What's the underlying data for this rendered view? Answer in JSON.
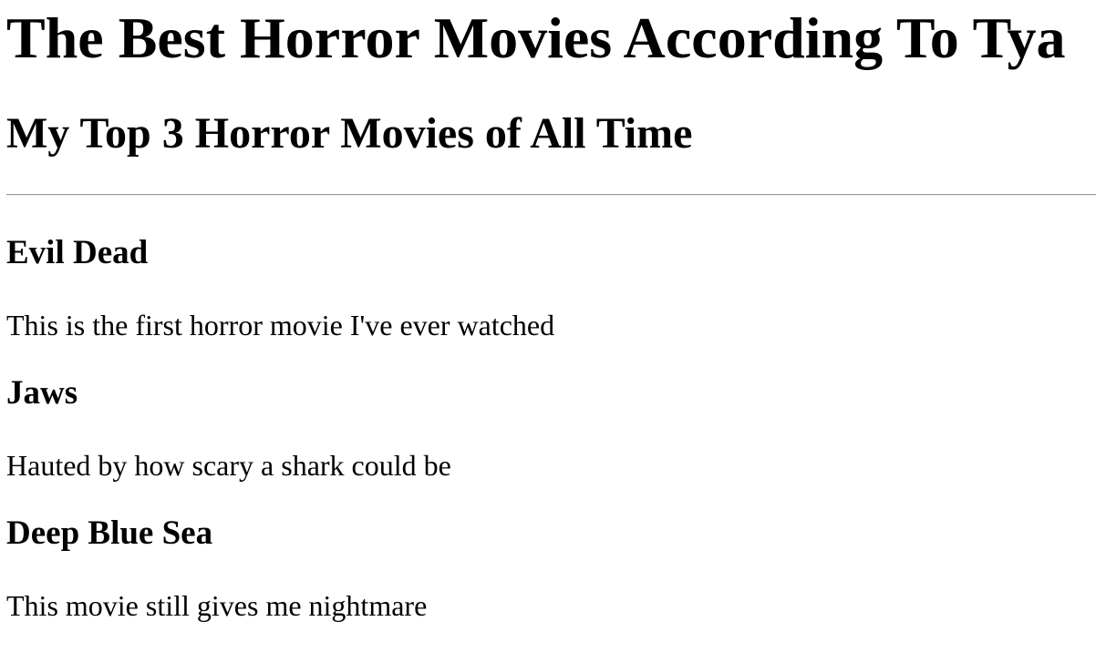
{
  "page": {
    "title": "The Best Horror Movies According To Tya",
    "subtitle": "My Top 3 Horror Movies of All Time"
  },
  "movies": [
    {
      "title": "Evil Dead",
      "description": "This is the first horror movie I've ever watched"
    },
    {
      "title": "Jaws",
      "description": "Hauted by how scary a shark could be"
    },
    {
      "title": "Deep Blue Sea",
      "description": "This movie still gives me nightmare"
    }
  ]
}
